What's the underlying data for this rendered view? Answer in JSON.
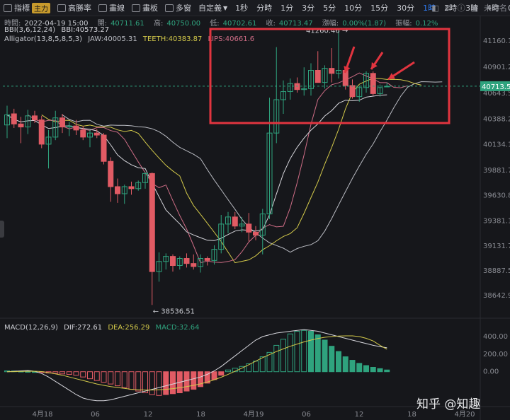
{
  "toolbar": {
    "items": [
      {
        "label": "指標",
        "icon": "indicator-icon",
        "tag": "主力"
      },
      {
        "label": "高勝率",
        "icon": "win-rate-icon"
      },
      {
        "label": "畫線",
        "icon": "draw-line-icon"
      },
      {
        "label": "畫板",
        "icon": "canvas-icon"
      },
      {
        "label": "多窗",
        "icon": "multi-window-icon"
      },
      {
        "label": "自定義",
        "icon": "dropdown-icon"
      }
    ],
    "timeframes": [
      "1秒",
      "分時",
      "1分",
      "3分",
      "5分",
      "10分",
      "15分",
      "30分",
      "1時",
      "2時",
      "3時",
      "4時",
      "0s"
    ],
    "active_timeframe": "1時",
    "right_label": "未命名",
    "right_icons": [
      "camera-icon",
      "settings-icon",
      "info-icon",
      "save-icon"
    ]
  },
  "info": {
    "time_label": "時間:",
    "time": "2022-04-19 15:00",
    "open_label": "開:",
    "open": "40711.61",
    "high_label": "高:",
    "high": "40750.00",
    "low_label": "低:",
    "low": "40702.61",
    "close_label": "收:",
    "close": "40713.47",
    "change_label": "漲幅:",
    "change": "0.00%(1.87)",
    "amp_label": "振幅:",
    "amp": "0.12%",
    "bbi_label": "BBI(3,6,12,24)",
    "bbi": "BBI:40573.27",
    "alligator_label": "Alligator(13,8,5,8,5,3)",
    "jaw": "JAW:40005.31",
    "teeth": "TEETH:40383.87",
    "lips": "LIPS:40661.6"
  },
  "macd_info": {
    "label": "MACD(12,26,9)",
    "dif": "DIF:272.61",
    "dea": "DEA:256.29",
    "macd": "MACD:32.64"
  },
  "watermark": "知乎 @知趣",
  "colors": {
    "up": "#2fa37e",
    "down": "#e15b64",
    "bbi": "#d6d6dc",
    "jaw": "#b9bbc2",
    "teeth": "#d3c94a",
    "lips": "#cf6d86",
    "highlight": "#e1343f",
    "dif": "#d6d6dc",
    "dea": "#d3c94a",
    "last": "#2fa37e"
  },
  "chart_data": {
    "type": "candlestick",
    "x_ticks": [
      "4月18",
      "06",
      "12",
      "18",
      "4月19",
      "06",
      "12",
      "18",
      "4月20"
    ],
    "y_ticks": [
      41160.17,
      40901.21,
      40643.58,
      40388.22,
      40134.13,
      39881.77,
      39630.86,
      39381.15,
      39131.75,
      38887.52,
      38642.95
    ],
    "last_price": 40713.47,
    "high_label": "41260.46",
    "low_label": "38536.51",
    "candles": [
      {
        "o": 40330,
        "h": 40520,
        "l": 40200,
        "c": 40430
      },
      {
        "o": 40440,
        "h": 40490,
        "l": 40300,
        "c": 40340
      },
      {
        "o": 40340,
        "h": 40410,
        "l": 40150,
        "c": 40310
      },
      {
        "o": 40310,
        "h": 40480,
        "l": 40240,
        "c": 40420
      },
      {
        "o": 40420,
        "h": 40470,
        "l": 40350,
        "c": 40380
      },
      {
        "o": 40380,
        "h": 40420,
        "l": 40100,
        "c": 40140
      },
      {
        "o": 40140,
        "h": 40280,
        "l": 39900,
        "c": 40210
      },
      {
        "o": 40210,
        "h": 40470,
        "l": 40180,
        "c": 40400
      },
      {
        "o": 40400,
        "h": 40440,
        "l": 40250,
        "c": 40310
      },
      {
        "o": 40310,
        "h": 40360,
        "l": 40220,
        "c": 40320
      },
      {
        "o": 40320,
        "h": 40380,
        "l": 40230,
        "c": 40280
      },
      {
        "o": 40280,
        "h": 40320,
        "l": 40180,
        "c": 40210
      },
      {
        "o": 40210,
        "h": 40280,
        "l": 40110,
        "c": 40250
      },
      {
        "o": 40250,
        "h": 40290,
        "l": 40200,
        "c": 40230
      },
      {
        "o": 40230,
        "h": 40250,
        "l": 39940,
        "c": 39970
      },
      {
        "o": 39970,
        "h": 40010,
        "l": 39570,
        "c": 39720
      },
      {
        "o": 39720,
        "h": 39800,
        "l": 39560,
        "c": 39650
      },
      {
        "o": 39650,
        "h": 39740,
        "l": 39550,
        "c": 39720
      },
      {
        "o": 39720,
        "h": 39770,
        "l": 39640,
        "c": 39700
      },
      {
        "o": 39700,
        "h": 39780,
        "l": 39680,
        "c": 39760
      },
      {
        "o": 39760,
        "h": 39860,
        "l": 39700,
        "c": 39850
      },
      {
        "o": 39850,
        "h": 39860,
        "l": 38550,
        "c": 38880
      },
      {
        "o": 38880,
        "h": 39070,
        "l": 38780,
        "c": 38980
      },
      {
        "o": 38980,
        "h": 39060,
        "l": 38900,
        "c": 39030
      },
      {
        "o": 39030,
        "h": 39050,
        "l": 38880,
        "c": 38940
      },
      {
        "o": 38940,
        "h": 39030,
        "l": 38900,
        "c": 39010
      },
      {
        "o": 39010,
        "h": 39060,
        "l": 38920,
        "c": 38960
      },
      {
        "o": 38960,
        "h": 39050,
        "l": 38900,
        "c": 38930
      },
      {
        "o": 38930,
        "h": 39050,
        "l": 38870,
        "c": 39010
      },
      {
        "o": 39010,
        "h": 39030,
        "l": 38940,
        "c": 38990
      },
      {
        "o": 38990,
        "h": 39140,
        "l": 38950,
        "c": 39100
      },
      {
        "o": 39100,
        "h": 39440,
        "l": 39060,
        "c": 39350
      },
      {
        "o": 39350,
        "h": 39470,
        "l": 39260,
        "c": 39420
      },
      {
        "o": 39420,
        "h": 39470,
        "l": 39300,
        "c": 39330
      },
      {
        "o": 39330,
        "h": 39420,
        "l": 39270,
        "c": 39350
      },
      {
        "o": 39350,
        "h": 39460,
        "l": 39180,
        "c": 39270
      },
      {
        "o": 39270,
        "h": 39330,
        "l": 39190,
        "c": 39240
      },
      {
        "o": 39240,
        "h": 39500,
        "l": 39050,
        "c": 39450
      },
      {
        "o": 39450,
        "h": 40600,
        "l": 39400,
        "c": 40250
      },
      {
        "o": 40250,
        "h": 41100,
        "l": 40150,
        "c": 40580
      },
      {
        "o": 40580,
        "h": 40770,
        "l": 40440,
        "c": 40660
      },
      {
        "o": 40660,
        "h": 40790,
        "l": 40580,
        "c": 40740
      },
      {
        "o": 40740,
        "h": 40800,
        "l": 40650,
        "c": 40680
      },
      {
        "o": 40680,
        "h": 40900,
        "l": 40620,
        "c": 40690
      },
      {
        "o": 40690,
        "h": 40940,
        "l": 40620,
        "c": 40870
      },
      {
        "o": 40870,
        "h": 41060,
        "l": 40750,
        "c": 40750
      },
      {
        "o": 40750,
        "h": 40920,
        "l": 40690,
        "c": 40890
      },
      {
        "o": 40890,
        "h": 41090,
        "l": 40750,
        "c": 40840
      },
      {
        "o": 40840,
        "h": 41260,
        "l": 40790,
        "c": 40870
      },
      {
        "o": 40870,
        "h": 40900,
        "l": 40680,
        "c": 40720
      },
      {
        "o": 40720,
        "h": 40780,
        "l": 40590,
        "c": 40610
      },
      {
        "o": 40610,
        "h": 40720,
        "l": 40560,
        "c": 40700
      },
      {
        "o": 40700,
        "h": 40860,
        "l": 40650,
        "c": 40840
      },
      {
        "o": 40840,
        "h": 40860,
        "l": 40620,
        "c": 40640
      },
      {
        "o": 40640,
        "h": 40730,
        "l": 40610,
        "c": 40700
      },
      {
        "o": 40712,
        "h": 40750,
        "l": 40703,
        "c": 40713
      }
    ],
    "macd_axis": [
      400,
      200,
      0.0
    ],
    "macd_hist": [
      10,
      8,
      5,
      2,
      0,
      -10,
      -15,
      -20,
      -25,
      -30,
      -40,
      -60,
      -80,
      -100,
      -120,
      -140,
      -160,
      -180,
      -200,
      -220,
      -240,
      -260,
      -270,
      -260,
      -250,
      -240,
      -220,
      -200,
      -170,
      -130,
      -90,
      -40,
      20,
      40,
      60,
      90,
      120,
      170,
      220,
      300,
      370,
      430,
      460,
      470,
      460,
      420,
      360,
      290,
      230,
      170,
      130,
      95,
      70,
      50,
      35,
      20
    ],
    "macd_dif": [
      0,
      5,
      10,
      15,
      5,
      -20,
      -60,
      -110,
      -160,
      -210,
      -260,
      -300,
      -320,
      -330,
      -330,
      -320,
      -300,
      -280,
      -260,
      -240,
      -220,
      -200,
      -180,
      -160,
      -140,
      -120,
      -100,
      -80,
      -60,
      -30,
      10,
      60,
      120,
      180,
      240,
      300,
      360,
      400,
      420,
      440,
      450,
      460,
      470,
      480,
      470,
      460,
      440,
      420,
      400,
      380,
      360,
      340,
      320,
      300,
      285,
      272
    ],
    "macd_dea": [
      0,
      1,
      3,
      5,
      6,
      2,
      -10,
      -25,
      -40,
      -60,
      -80,
      -100,
      -120,
      -140,
      -155,
      -170,
      -180,
      -190,
      -200,
      -205,
      -208,
      -208,
      -205,
      -200,
      -192,
      -182,
      -170,
      -155,
      -138,
      -117,
      -92,
      -63,
      -30,
      5,
      40,
      80,
      120,
      160,
      195,
      230,
      260,
      290,
      315,
      340,
      360,
      378,
      392,
      400,
      406,
      408,
      408,
      400,
      380,
      350,
      300,
      256
    ]
  }
}
